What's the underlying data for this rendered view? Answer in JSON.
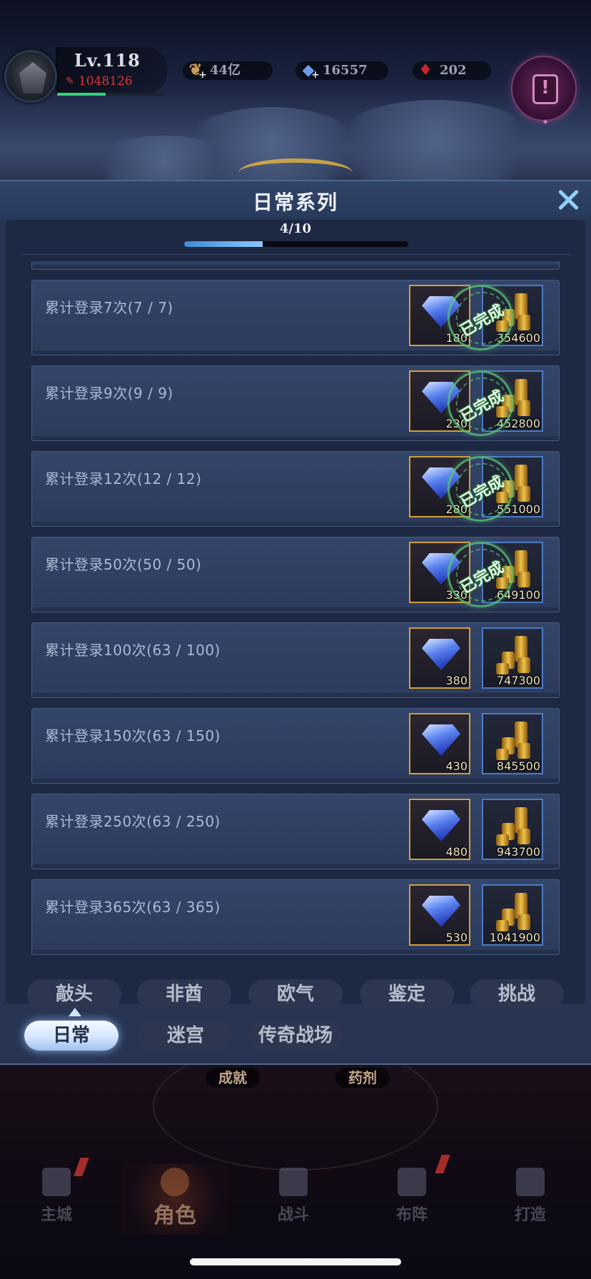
{
  "hud": {
    "level": "Lv.118",
    "power": "1048126",
    "exp_fraction": 0.45,
    "resources": [
      {
        "icon": "gold-feather-icon",
        "value": "44亿"
      },
      {
        "icon": "blue-crystal-icon",
        "value": "16557"
      },
      {
        "icon": "red-gem-icon",
        "value": "202"
      }
    ]
  },
  "panel": {
    "title": "日常系列",
    "progress_text": "4/10",
    "progress_fraction": 0.35
  },
  "rows": [
    {
      "label": "累计登录7次(7 / 7)",
      "diamond": "180",
      "gold": "354600",
      "completed": true
    },
    {
      "label": "累计登录9次(9 / 9)",
      "diamond": "230",
      "gold": "452800",
      "completed": true
    },
    {
      "label": "累计登录12次(12 / 12)",
      "diamond": "280",
      "gold": "551000",
      "completed": true
    },
    {
      "label": "累计登录50次(50 / 50)",
      "diamond": "330",
      "gold": "649100",
      "completed": true
    },
    {
      "label": "累计登录100次(63 / 100)",
      "diamond": "380",
      "gold": "747300",
      "completed": false
    },
    {
      "label": "累计登录150次(63 / 150)",
      "diamond": "430",
      "gold": "845500",
      "completed": false
    },
    {
      "label": "累计登录250次(63 / 250)",
      "diamond": "480",
      "gold": "943700",
      "completed": false
    },
    {
      "label": "累计登录365次(63 / 365)",
      "diamond": "530",
      "gold": "1041900",
      "completed": false
    }
  ],
  "completed_stamp": "已完成",
  "tabs": {
    "row1": [
      "敲头",
      "非酋",
      "欧气",
      "鉴定",
      "挑战"
    ],
    "row2": [
      "日常",
      "迷宫",
      "传奇战场"
    ],
    "active": "日常"
  },
  "small_labels": [
    "成就",
    "药剂"
  ],
  "nav": [
    {
      "label": "主城",
      "icon": "castle-icon"
    },
    {
      "label": "角色",
      "icon": "helmet-icon",
      "active": true
    },
    {
      "label": "战斗",
      "icon": "crossed-swords-icon"
    },
    {
      "label": "布阵",
      "icon": "formation-icon"
    },
    {
      "label": "打造",
      "icon": "anvil-icon"
    }
  ]
}
